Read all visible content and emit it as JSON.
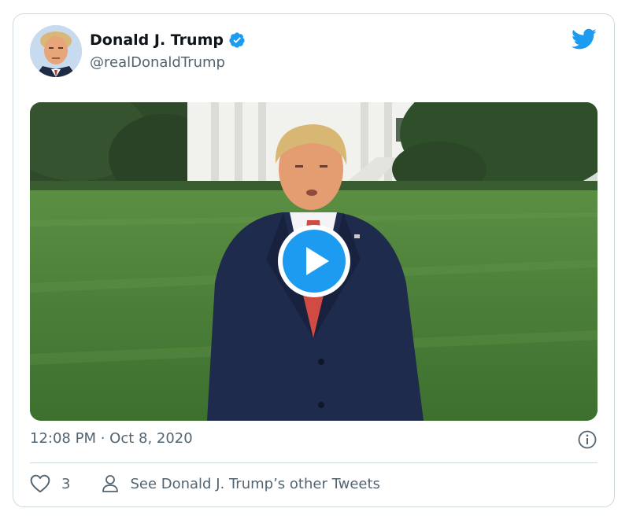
{
  "tweet": {
    "author": {
      "display_name": "Donald J. Trump",
      "handle": "@realDonaldTrump",
      "verified": true,
      "avatar_icon": "profile-photo"
    },
    "media": {
      "type": "video",
      "play_icon": "play-icon",
      "description_colors": {
        "play_button": "#1d9bf0"
      }
    },
    "timestamp": "12:08 PM · Oct 8, 2020",
    "info_icon": "info-icon",
    "actions": {
      "like_count": "3",
      "see_others_label": "See Donald J. Trump’s other Tweets"
    },
    "brand": {
      "logo_icon": "twitter-bird-icon",
      "accent": "#1d9bf0"
    }
  }
}
